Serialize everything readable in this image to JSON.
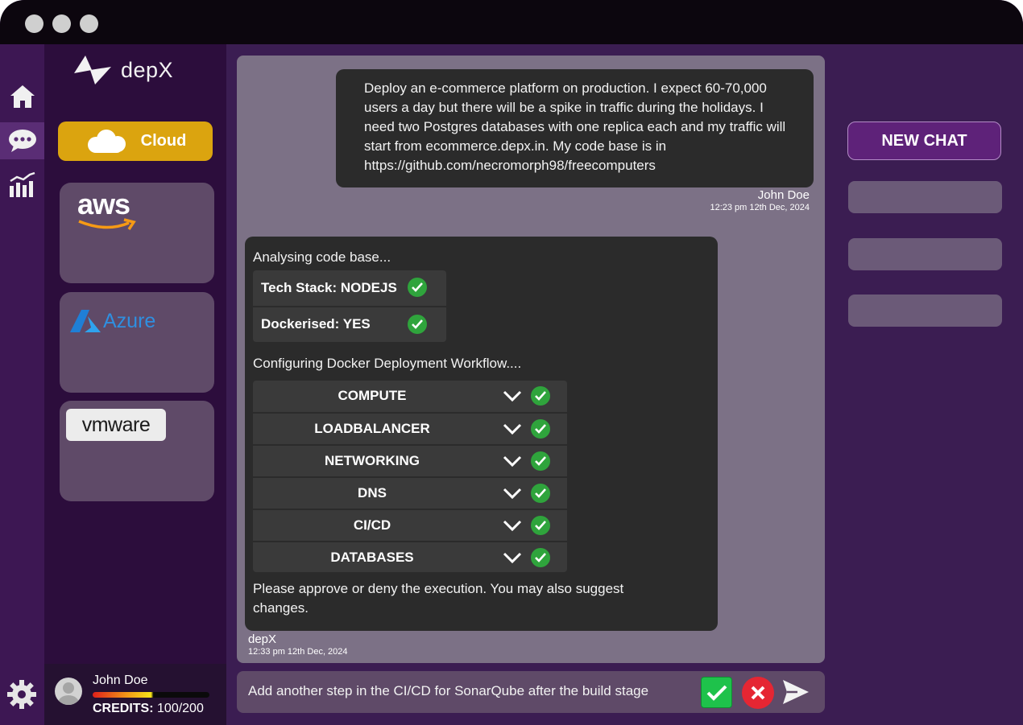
{
  "app": {
    "brand": "depX"
  },
  "sidebar": {
    "cloud_label": "Cloud",
    "providers": [
      {
        "name": "aws",
        "label": "aws"
      },
      {
        "name": "azure",
        "label": "Azure"
      },
      {
        "name": "vmware",
        "label": "vmware"
      }
    ]
  },
  "user": {
    "name": "John Doe",
    "credits_label": "CREDITS:",
    "credits_value": "100/200",
    "credits_fraction": 0.5
  },
  "chat": {
    "user_message": {
      "text": "Deploy an e-commerce platform on production. I expect 60-70,000 users a day but there will be a spike in traffic during the holidays. I need two Postgres databases with one replica each and my traffic will start from ecommerce.depx.in. My code base is in https://github.com/necromorph98/freecomputers",
      "author": "John Doe",
      "timestamp": "12:23 pm 12th Dec, 2024"
    },
    "bot_message": {
      "analysing": "Analysing code base...",
      "checks": [
        {
          "label": "Tech Stack: NODEJS"
        },
        {
          "label": "Dockerised: YES"
        }
      ],
      "configuring": "Configuring Docker Deployment Workflow....",
      "workflow": [
        {
          "label": "COMPUTE"
        },
        {
          "label": "LOADBALANCER"
        },
        {
          "label": "NETWORKING"
        },
        {
          "label": "DNS"
        },
        {
          "label": "CI/CD"
        },
        {
          "label": "DATABASES"
        }
      ],
      "approval_text": "Please approve or deny the execution. You may also suggest changes.",
      "author": "depX",
      "timestamp": "12:33 pm 12th Dec, 2024"
    }
  },
  "input": {
    "value": "Add another step in the CI/CD for SonarQube after the build stage"
  },
  "right_panel": {
    "new_chat_label": "NEW CHAT",
    "history_count": 3
  },
  "colors": {
    "accent": "#dba40f",
    "success": "#2fa43c",
    "danger": "#e52633",
    "new_chat": "#5e2279"
  }
}
